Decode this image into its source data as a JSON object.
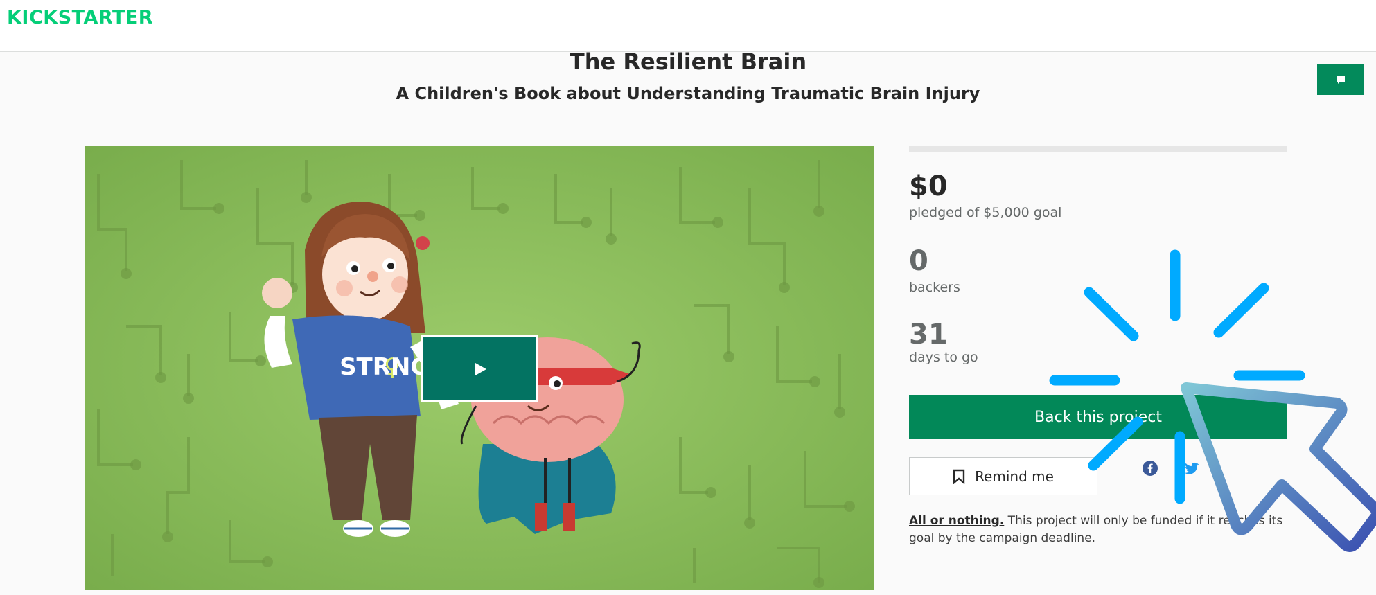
{
  "header": {
    "logo_text": "KICKSTARTER"
  },
  "project": {
    "title": "The Resilient Brain",
    "subtitle": "A Children's Book about Understanding Traumatic Brain Injury",
    "hero_shirt_text": "STR♀NG"
  },
  "funding": {
    "amount": "$0",
    "pledged_label": "pledged of $5,000 goal",
    "progress_fraction": 0,
    "backers_count": "0",
    "backers_label": "backers",
    "days_count": "31",
    "days_label": "days to go"
  },
  "actions": {
    "back_label": "Back this project",
    "remind_label": "Remind me"
  },
  "fine_print": {
    "all_or_nothing": "All or nothing.",
    "body": " This project will only be funded if it reaches its goal by the campaign deadline."
  },
  "colors": {
    "brand_green": "#05ce78",
    "button_green": "#028858",
    "play_green": "#037362",
    "click_blue": "#00aaff"
  },
  "icons": [
    "chat-icon",
    "play-icon",
    "bookmark-icon",
    "facebook-icon",
    "twitter-icon",
    "cursor-icon",
    "click-burst-icon"
  ]
}
